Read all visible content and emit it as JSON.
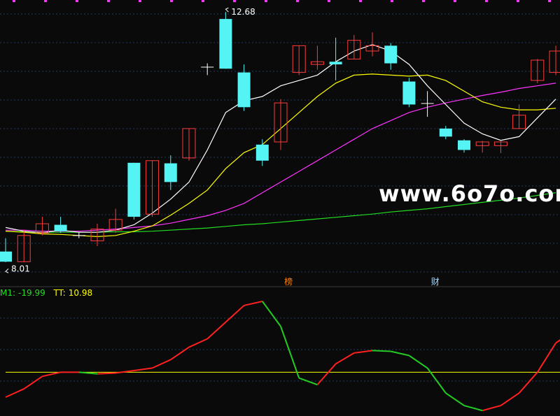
{
  "watermark": "www.6o7o.com",
  "colors": {
    "up": "#ff3b3b",
    "down": "#54f4f4",
    "ma5": "#ffffff",
    "ma10": "#ffff00",
    "ma20": "#ff33ff",
    "ma60": "#22dd22",
    "grid": "#1e3a5f",
    "osc_up": "#ff2020",
    "osc_down": "#22cc22",
    "tt": "#ffff00",
    "m1_label": "#22dd22",
    "tt_label": "#ffff00"
  },
  "markers": [
    {
      "text": "榜",
      "x_index": 15.5,
      "color": "#ff8000"
    },
    {
      "text": "财",
      "x_index": 23.5,
      "color": "#aaddff"
    }
  ],
  "indicator_readout": {
    "m1_label": "M1:",
    "m1_value": "-19.99",
    "tt_label": "TT:",
    "tt_value": "10.98"
  },
  "chart_data": [
    {
      "type": "candlestick",
      "price_range": [
        7.7,
        12.8
      ],
      "annotations": [
        {
          "text": "12.68",
          "index": 12,
          "price": 12.68
        },
        {
          "text": "8.01",
          "index": 0,
          "price": 8.01
        }
      ],
      "candles": [
        {
          "o": 8.2,
          "c": 8.01,
          "h": 8.45,
          "l": 8.0
        },
        {
          "o": 8.01,
          "c": 8.5,
          "h": 8.6,
          "l": 8.0
        },
        {
          "o": 8.55,
          "c": 8.72,
          "h": 8.85,
          "l": 8.5
        },
        {
          "o": 8.7,
          "c": 8.58,
          "h": 8.85,
          "l": 8.55
        },
        {
          "o": 8.5,
          "c": 8.5,
          "h": 8.56,
          "l": 8.45
        },
        {
          "o": 8.4,
          "c": 8.62,
          "h": 8.72,
          "l": 8.3
        },
        {
          "o": 8.6,
          "c": 8.8,
          "h": 9.0,
          "l": 8.55
        },
        {
          "o": 9.86,
          "c": 8.85,
          "h": 9.86,
          "l": 8.8
        },
        {
          "o": 8.9,
          "c": 9.9,
          "h": 9.9,
          "l": 8.85
        },
        {
          "o": 9.85,
          "c": 9.5,
          "h": 10.0,
          "l": 9.35
        },
        {
          "o": 9.95,
          "c": 10.5,
          "h": 10.5,
          "l": 9.9
        },
        {
          "o": 11.65,
          "c": 11.65,
          "h": 11.72,
          "l": 11.5
        },
        {
          "o": 12.55,
          "c": 11.62,
          "h": 12.68,
          "l": 11.62
        },
        {
          "o": 11.55,
          "c": 10.9,
          "h": 11.7,
          "l": 10.83
        },
        {
          "o": 10.2,
          "c": 9.9,
          "h": 10.3,
          "l": 9.8
        },
        {
          "o": 10.25,
          "c": 10.98,
          "h": 11.05,
          "l": 10.1
        },
        {
          "o": 11.55,
          "c": 12.05,
          "h": 12.05,
          "l": 11.5
        },
        {
          "o": 11.7,
          "c": 11.75,
          "h": 12.05,
          "l": 11.6
        },
        {
          "o": 11.75,
          "c": 11.7,
          "h": 12.2,
          "l": 11.4
        },
        {
          "o": 11.8,
          "c": 12.15,
          "h": 12.25,
          "l": 11.8
        },
        {
          "o": 11.95,
          "c": 12.05,
          "h": 12.3,
          "l": 11.85
        },
        {
          "o": 12.05,
          "c": 11.72,
          "h": 12.1,
          "l": 11.6
        },
        {
          "o": 11.38,
          "c": 10.95,
          "h": 11.45,
          "l": 10.9
        },
        {
          "o": 10.97,
          "c": 10.97,
          "h": 11.2,
          "l": 10.72
        },
        {
          "o": 10.5,
          "c": 10.35,
          "h": 10.55,
          "l": 10.3
        },
        {
          "o": 10.28,
          "c": 10.1,
          "h": 10.3,
          "l": 10.05
        },
        {
          "o": 10.18,
          "c": 10.25,
          "h": 10.27,
          "l": 10.05
        },
        {
          "o": 10.18,
          "c": 10.25,
          "h": 10.27,
          "l": 10.04
        },
        {
          "o": 10.5,
          "c": 10.75,
          "h": 10.95,
          "l": 10.5
        },
        {
          "o": 11.4,
          "c": 11.78,
          "h": 11.8,
          "l": 11.35
        },
        {
          "o": 11.55,
          "c": 11.95,
          "h": 12.05,
          "l": 11.5
        }
      ],
      "ma5": [
        8.65,
        8.58,
        8.55,
        8.6,
        8.56,
        8.56,
        8.6,
        8.7,
        8.92,
        9.18,
        9.5,
        10.1,
        10.8,
        11.02,
        11.1,
        11.3,
        11.4,
        11.5,
        11.75,
        11.95,
        12.07,
        11.95,
        11.7,
        11.3,
        10.95,
        10.6,
        10.4,
        10.28,
        10.35,
        10.7,
        11.05
      ],
      "ma10": [
        8.58,
        8.56,
        8.53,
        8.52,
        8.5,
        8.48,
        8.5,
        8.58,
        8.68,
        8.88,
        9.1,
        9.35,
        9.75,
        10.05,
        10.2,
        10.5,
        10.8,
        11.1,
        11.35,
        11.5,
        11.52,
        11.5,
        11.48,
        11.5,
        11.4,
        11.2,
        11.0,
        10.9,
        10.85,
        10.85,
        10.88
      ],
      "ma20": [
        8.6,
        8.6,
        8.58,
        8.58,
        8.58,
        8.6,
        8.62,
        8.65,
        8.68,
        8.73,
        8.8,
        8.87,
        8.97,
        9.1,
        9.3,
        9.5,
        9.7,
        9.9,
        10.1,
        10.3,
        10.5,
        10.65,
        10.8,
        10.9,
        10.98,
        11.05,
        11.12,
        11.18,
        11.25,
        11.3,
        11.35
      ],
      "ma60": [
        8.58,
        8.57,
        8.56,
        8.56,
        8.56,
        8.56,
        8.57,
        8.57,
        8.58,
        8.6,
        8.62,
        8.64,
        8.67,
        8.7,
        8.72,
        8.75,
        8.78,
        8.81,
        8.84,
        8.87,
        8.9,
        8.94,
        8.97,
        9.0,
        9.04,
        9.08,
        9.12,
        9.16,
        9.2,
        9.25,
        9.3
      ]
    },
    {
      "type": "line",
      "range": [
        -60,
        80
      ],
      "series": [
        {
          "name": "M1",
          "values": [
            -40,
            -30,
            -15,
            -10,
            -10,
            -12,
            -11,
            -8,
            -5,
            5,
            20,
            30,
            50,
            70,
            75,
            45,
            -17,
            -25,
            0,
            13,
            16,
            15,
            10,
            -5,
            -35,
            -50,
            -56,
            -50,
            -35,
            -10,
            25,
            40,
            41
          ]
        },
        {
          "name": "TT",
          "values": [
            -10,
            -10,
            -10,
            -10,
            -10,
            -10,
            -10,
            -10,
            -10,
            -10,
            -10,
            -10,
            -10,
            -10,
            -10,
            -10,
            -10,
            -10,
            -10,
            -10,
            -10,
            -10,
            -10,
            -10,
            -10,
            -10,
            -10,
            -10,
            -10,
            -10,
            -10,
            -10,
            -10
          ]
        }
      ]
    }
  ]
}
